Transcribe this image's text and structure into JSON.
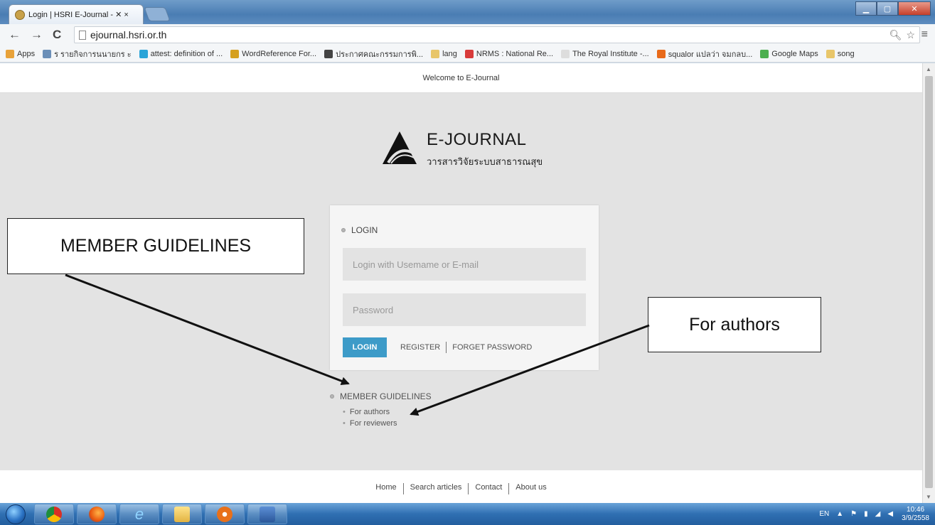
{
  "browser": {
    "tab_title": "Login | HSRI E-Journal - ✕ ×",
    "tab_close": "×",
    "url": "ejournal.hsri.or.th",
    "bookmarks": [
      {
        "label": "Apps",
        "icon": "apps-grid-icon",
        "color": "#e8a23a"
      },
      {
        "label": "ร รายกิจการนนายกร ะ",
        "icon": "image-bookmark-icon",
        "color": "#6b8fb8"
      },
      {
        "label": "attest: definition of ...",
        "icon": "dictionary-icon",
        "color": "#2aa4d8"
      },
      {
        "label": "WordReference For...",
        "icon": "wordreference-icon",
        "color": "#d5a020"
      },
      {
        "label": "ประกาศคณะกรรมการพิ...",
        "icon": "government-seal-icon",
        "color": "#444444"
      },
      {
        "label": "lang",
        "icon": "folder-icon",
        "color": "#e8c66a"
      },
      {
        "label": "NRMS : National Re...",
        "icon": "nrms-icon",
        "color": "#d83b3b"
      },
      {
        "label": "The Royal Institute -...",
        "icon": "page-icon",
        "color": "#dddddd"
      },
      {
        "label": "squalor แปลว่า จมกลบ...",
        "icon": "dictionary-orange-icon",
        "color": "#e86a1a"
      },
      {
        "label": "Google Maps",
        "icon": "google-maps-icon",
        "color": "#4caf50"
      },
      {
        "label": "song",
        "icon": "folder-icon",
        "color": "#e8c66a"
      }
    ]
  },
  "page": {
    "welcome": "Welcome to E-Journal",
    "logo_title": "E-JOURNAL",
    "logo_subtitle": "วารสารวิจัยระบบสาธารณสุข",
    "login": {
      "heading": "LOGIN",
      "username_placeholder": "Login with Usemame or E-mail",
      "password_placeholder": "Password",
      "button": "LOGIN",
      "register": "REGISTER",
      "forget": "FORGET PASSWORD"
    },
    "guidelines": {
      "title": "MEMBER GUIDELINES",
      "items": [
        "For authors",
        "For reviewers"
      ]
    },
    "footer": {
      "links": [
        "Home",
        "Search articles",
        "Contact",
        "About us"
      ]
    }
  },
  "annotations": {
    "member": "MEMBER GUIDELINES",
    "authors": "For authors"
  },
  "taskbar": {
    "lang": "EN",
    "time": "10:46",
    "date": "3/9/2558"
  },
  "colors": {
    "login_button": "#3d9bc8",
    "page_bg": "#e3e3e3",
    "taskbar": "#2f6fb2"
  }
}
